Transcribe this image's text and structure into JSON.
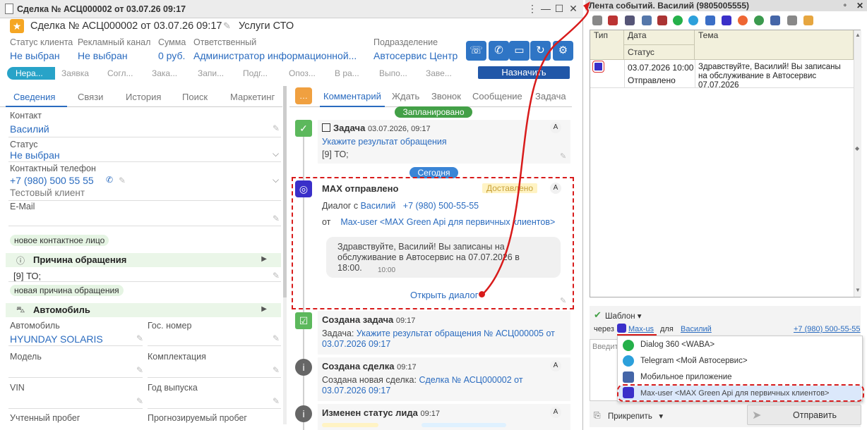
{
  "window": {
    "title": "Сделка № АСЦ000002 от 03.07.26 09:17"
  },
  "header": {
    "title": "Сделка № АСЦ000002 от 03.07.26 09:17",
    "service": "Услуги СТО"
  },
  "fields": {
    "status_label": "Статус клиента",
    "status_value": "Не выбран",
    "channel_label": "Рекламный канал",
    "channel_value": "Не выбран",
    "sum_label": "Сумма",
    "sum_value": "0 руб.",
    "responsible_label": "Ответственный",
    "responsible_value": "Администратор информационной...",
    "division_label": "Подразделение",
    "division_value": "Автосервис Центр"
  },
  "stages": [
    "Нера...",
    "Заявка",
    "Согл...",
    "Зака...",
    "Запи...",
    "Подг...",
    "Опоз...",
    "В ра...",
    "Выпо...",
    "Заве..."
  ],
  "assign_label": "Назначить",
  "left_tabs": [
    "Сведения",
    "Связи",
    "История",
    "Поиск",
    "Маркетинг"
  ],
  "contact": {
    "contact_label": "Контакт",
    "contact_value": "Василий",
    "status_label": "Статус",
    "status_value": "Не выбран",
    "phone_label": "Контактный телефон",
    "phone_value": "+7 (980) 500 55 55",
    "phone_note": "Тестовый клиент",
    "email_label": "E-Mail",
    "chip1": "новое контактное лицо"
  },
  "reason": {
    "title": "Причина обращения",
    "value": "[9] ТО;",
    "chip": "новая причина обращения"
  },
  "car": {
    "title": "Автомобиль",
    "car_label": "Автомобиль",
    "car_value": "HYUNDAY SOLARIS",
    "plate_label": "Гос. номер",
    "model_label": "Модель",
    "config_label": "Комплектация",
    "vin_label": "VIN",
    "year_label": "Год выпуска",
    "mileage_label": "Учтенный пробег",
    "forecast_label": "Прогнозируемый пробег"
  },
  "right_tabs": [
    "Комментарий",
    "Ждать",
    "Звонок",
    "Сообщение",
    "Задача"
  ],
  "pills": {
    "planned": "Запланировано",
    "today": "Сегодня"
  },
  "events": {
    "task": {
      "title": "Задача",
      "time": "03.07.2026, 09:17",
      "link": "Укажите результат обращения",
      "text": "[9] ТО;"
    },
    "max": {
      "title": "MAX отправлено",
      "status": "Доставлено",
      "dialog_prefix": "Диалог с",
      "dialog_name": "Василий",
      "dialog_phone": "+7 (980) 500-55-55",
      "from_prefix": "от",
      "from_value": "Max-user <MAX Green Api для первичных клиентов>",
      "message": "Здравствуйте, Василий! Вы записаны на обслуживание в Автосервис на 07.07.2026 в 18:00.",
      "msg_time": "10:00",
      "open_dialog": "Открыть диалог"
    },
    "created_task": {
      "title": "Создана задача",
      "time": "09:17",
      "prefix": "Задача:",
      "link": "Укажите результат обращения № АСЦ000005 от 03.07.2026 09:17"
    },
    "created_deal": {
      "title": "Создана сделка",
      "time": "09:17",
      "prefix": "Создана новая сделка:",
      "link": "Сделка № АСЦ000002 от 03.07.2026 09:17"
    },
    "changed": {
      "title": "Изменен статус лида",
      "time": "09:17"
    },
    "badge": "A"
  },
  "side": {
    "title": "Лента событий. Василий  (9805005555)",
    "grid_headers": {
      "type": "Тип",
      "date": "Дата",
      "subject": "Тема",
      "status": "Статус"
    },
    "row": {
      "date": "03.07.2026 10:00",
      "status": "Отправлено",
      "subject": "Здравствуйте, Василий! Вы записаны на обслуживание в Автосервис 07.07.2026"
    },
    "template_label": "Шаблон",
    "via_label": "через",
    "via_value": "Max-us",
    "for_label": "для",
    "for_name": "Василий",
    "for_phone": "+7 (980) 500-55-55",
    "input_placeholder": "Введите",
    "menu": [
      "Dialog 360 <WABA>",
      "Telegram <Мой Автосервис>",
      "Мобильное приложение",
      "Max-user <MAX Green Api для первичных клиентов>"
    ],
    "attach_label": "Прикрепить",
    "send_label": "Отправить"
  },
  "colors": {
    "accent": "#2a6bbf",
    "highlight": "#d81b1b",
    "stage_active": "#28a3c8"
  }
}
